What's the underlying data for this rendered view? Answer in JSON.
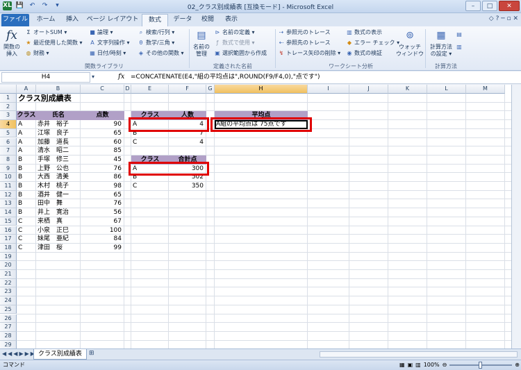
{
  "window": {
    "title": "02_クラス別成績表 [互換モード] - Microsoft Excel"
  },
  "qat": [
    "XL",
    "💾",
    "↶",
    "↷",
    "▾"
  ],
  "tabs": [
    "ファイル",
    "ホーム",
    "挿入",
    "ページ レイアウト",
    "数式",
    "データ",
    "校閲",
    "表示"
  ],
  "ribbon": {
    "insert_function": "関数の\n挿入",
    "autosum": "オートSUM ▾",
    "recent": "最近使用した関数 ▾",
    "financial": "財務 ▾",
    "logical": "論理 ▾",
    "text": "文字列操作 ▾",
    "datetime": "日付/時刻 ▾",
    "lookup": "検索/行列 ▾",
    "math": "数学/三角 ▾",
    "more": "その他の関数 ▾",
    "group_library": "関数ライブラリ",
    "name_manager": "名前の\n管理",
    "define_name": "名前の定義 ▾",
    "use_in_formula": "数式で使用 ▾",
    "create_from_sel": "選択範囲から作成",
    "group_names": "定義された名前",
    "trace_prec": "参照元のトレース",
    "trace_dep": "参照先のトレース",
    "remove_arrows": "トレース矢印の削除 ▾",
    "show_formulas": "数式の表示",
    "error_check": "エラー チェック ▾",
    "evaluate": "数式の検証",
    "watch": "ウォッチ\nウィンドウ",
    "group_audit": "ワークシート分析",
    "calc_options": "計算方法\nの設定 ▾",
    "group_calc": "計算方法"
  },
  "formula_bar": {
    "name_box": "H4",
    "fx": "fx",
    "formula": "=CONCATENATE(E4,\"組の平均点は\",ROUND(F9/F4,0),\"点です\")"
  },
  "columns": [
    "A",
    "B",
    "C",
    "D",
    "E",
    "F",
    "G",
    "H",
    "I",
    "J",
    "K",
    "L",
    "M"
  ],
  "rows": [
    "1",
    "2",
    "3",
    "4",
    "5",
    "6",
    "7",
    "8",
    "9",
    "10",
    "11",
    "12",
    "13",
    "14",
    "15",
    "16",
    "17",
    "18",
    "19",
    "20",
    "21",
    "22",
    "23",
    "24",
    "25",
    "26",
    "27",
    "28",
    "29"
  ],
  "sheet": {
    "title": "クラス別成績表",
    "headers": {
      "class": "クラス",
      "name": "氏名",
      "score": "点数"
    },
    "students": [
      {
        "c": "A",
        "n": "赤井　裕子",
        "s": "90"
      },
      {
        "c": "A",
        "n": "江塚　良子",
        "s": "65"
      },
      {
        "c": "A",
        "n": "加藤　道長",
        "s": "60"
      },
      {
        "c": "A",
        "n": "清水　昭二",
        "s": "85"
      },
      {
        "c": "B",
        "n": "手塚　修三",
        "s": "45"
      },
      {
        "c": "B",
        "n": "上野　公也",
        "s": "76"
      },
      {
        "c": "B",
        "n": "大西　清美",
        "s": "86"
      },
      {
        "c": "B",
        "n": "木村　桃子",
        "s": "98"
      },
      {
        "c": "B",
        "n": "酒井　健一",
        "s": "65"
      },
      {
        "c": "B",
        "n": "田中　舞",
        "s": "76"
      },
      {
        "c": "B",
        "n": "井上　寛治",
        "s": "56"
      },
      {
        "c": "C",
        "n": "来栖　真",
        "s": "67"
      },
      {
        "c": "C",
        "n": "小泉　正巳",
        "s": "100"
      },
      {
        "c": "C",
        "n": "妹尾　亜紀",
        "s": "84"
      },
      {
        "c": "C",
        "n": "津田　桜",
        "s": "99"
      }
    ],
    "count_table": {
      "h1": "クラス",
      "h2": "人数",
      "rows": [
        {
          "c": "A",
          "v": "4"
        },
        {
          "c": "B",
          "v": "7"
        },
        {
          "c": "C",
          "v": "4"
        }
      ]
    },
    "sum_table": {
      "h1": "クラス",
      "h2": "合計点",
      "rows": [
        {
          "c": "A",
          "v": "300"
        },
        {
          "c": "B",
          "v": "502"
        },
        {
          "c": "C",
          "v": "350"
        }
      ]
    },
    "avg": {
      "header": "平均点",
      "value": "A組の平均点は 75点です"
    }
  },
  "sheet_tab": "クラス別成績表",
  "status": {
    "mode": "コマンド",
    "zoom": "100%"
  }
}
